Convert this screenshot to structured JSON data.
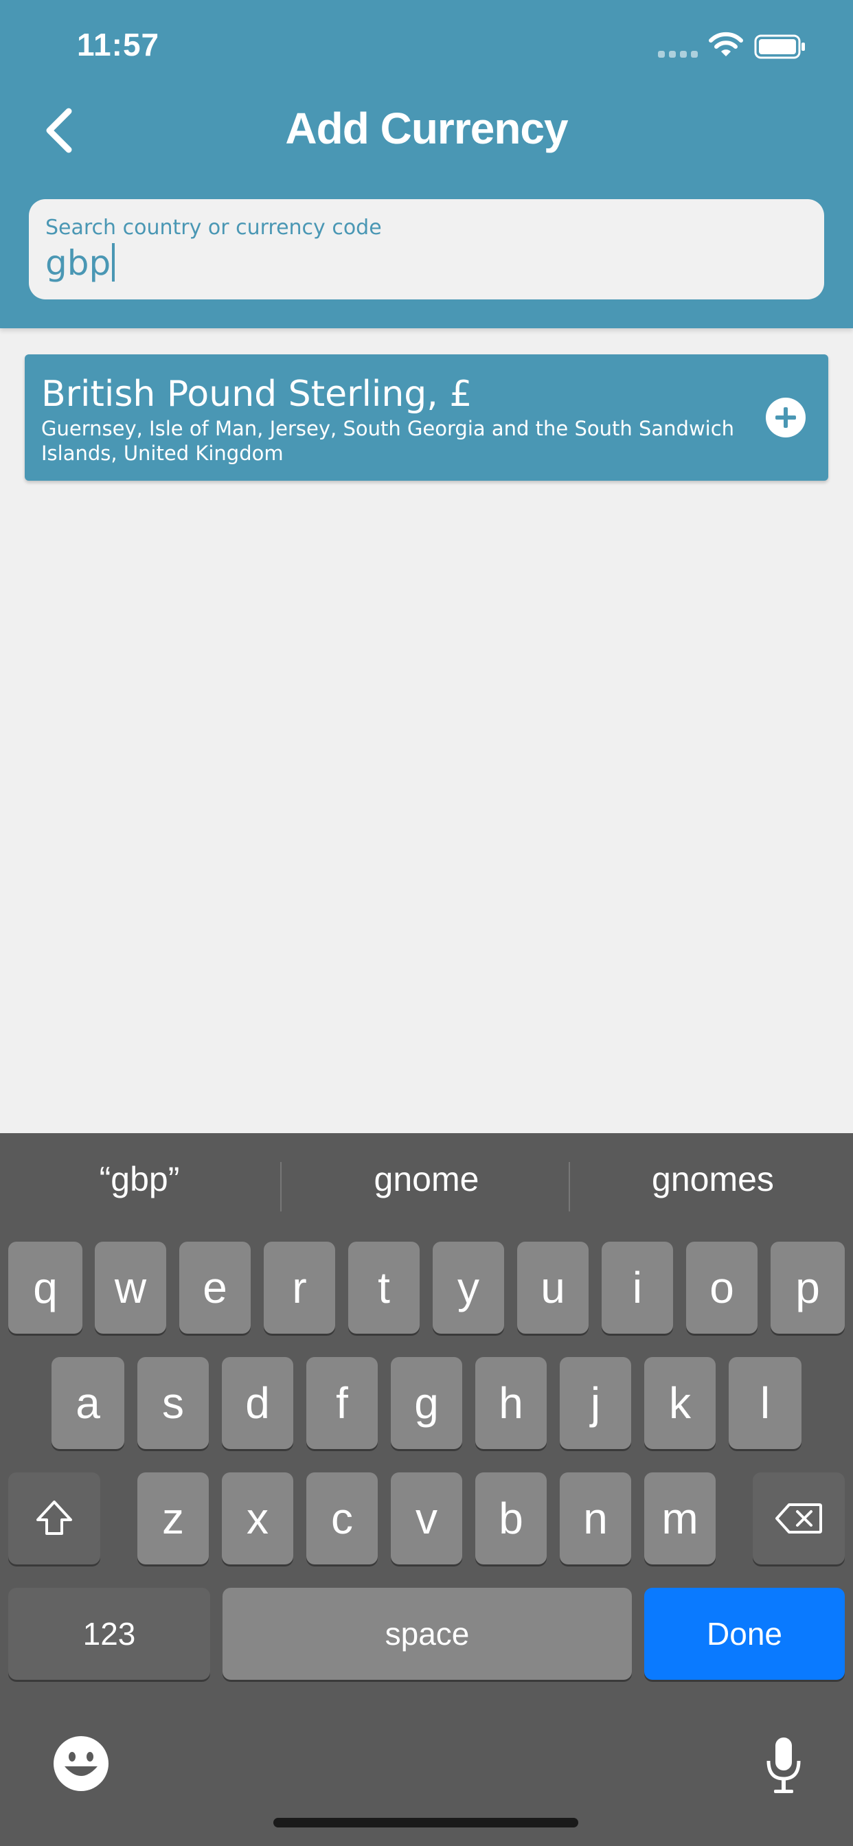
{
  "status_bar": {
    "time": "11:57"
  },
  "header": {
    "title": "Add Currency",
    "back_icon": "chevron-left-icon"
  },
  "search": {
    "label": "Search country or currency code",
    "value": "gbp"
  },
  "results": [
    {
      "title": "British Pound Sterling, £",
      "countries": "Guernsey, Isle of Man, Jersey, South Georgia and the South Sandwich Islands, United Kingdom",
      "action_icon": "plus-circle-icon"
    }
  ],
  "keyboard": {
    "suggestions": [
      "“gbp”",
      "gnome",
      "gnomes"
    ],
    "row1": [
      "q",
      "w",
      "e",
      "r",
      "t",
      "y",
      "u",
      "i",
      "o",
      "p"
    ],
    "row2": [
      "a",
      "s",
      "d",
      "f",
      "g",
      "h",
      "j",
      "k",
      "l"
    ],
    "row3": [
      "z",
      "x",
      "c",
      "v",
      "b",
      "n",
      "m"
    ],
    "numbers_key": "123",
    "space_key": "space",
    "done_key": "Done",
    "colors": {
      "done": "#0a7aff",
      "background": "#5a5a5a",
      "key": "#878787"
    }
  },
  "colors": {
    "accent": "#4a97b4",
    "background": "#f0f0f0"
  }
}
